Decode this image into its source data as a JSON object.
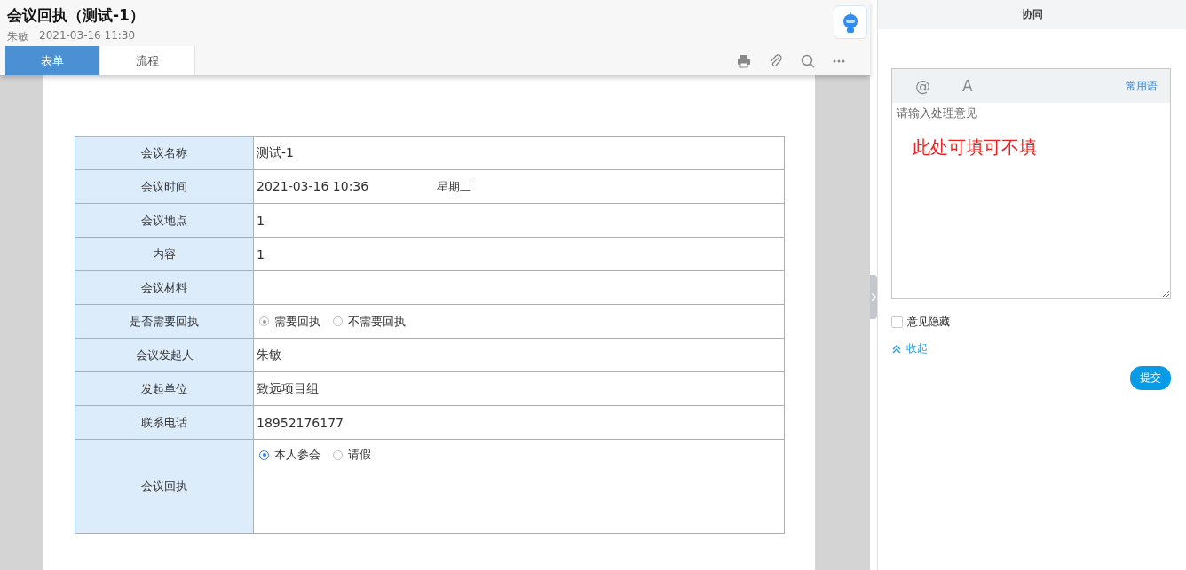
{
  "header": {
    "title": "会议回执（测试-1）",
    "author": "朱敏",
    "time": "2021-03-16 11:30"
  },
  "tabs": [
    {
      "label": "表单",
      "selected": true
    },
    {
      "label": "流程",
      "selected": false
    }
  ],
  "form": {
    "rows": [
      {
        "kind": "text",
        "label": "会议名称",
        "value": "测试-1"
      },
      {
        "kind": "datetime",
        "label": "会议时间",
        "value": "2021-03-16 10:36",
        "weekday": "星期二"
      },
      {
        "kind": "text",
        "label": "会议地点",
        "value": "1"
      },
      {
        "kind": "text",
        "label": "内容",
        "value": "1"
      },
      {
        "kind": "text",
        "label": "会议材料"
      },
      {
        "kind": "radio",
        "label": "是否需要回执",
        "disabled": true,
        "options": [
          {
            "label": "需要回执",
            "selected": true
          },
          {
            "label": "不需要回执",
            "selected": false
          }
        ]
      },
      {
        "kind": "text",
        "label": "会议发起人",
        "value": "朱敏"
      },
      {
        "kind": "text",
        "label": "发起单位",
        "value": "致远项目组"
      },
      {
        "kind": "text",
        "label": "联系电话",
        "value": "18952176177"
      },
      {
        "kind": "radio",
        "label": "会议回执",
        "disabled": false,
        "tall": true,
        "options": [
          {
            "label": "本人参会",
            "selected": true
          },
          {
            "label": "请假",
            "selected": false
          }
        ]
      }
    ]
  },
  "panel": {
    "title": "协同",
    "toolbar": [
      "@",
      "A"
    ],
    "phrases_link": "常用语",
    "placeholder": "请输入处理意见",
    "annotation": "此处可填可不填",
    "hide_opinion": {
      "label": "意见隐藏",
      "checked": false
    },
    "collapse": "收起",
    "submit": "提交"
  }
}
